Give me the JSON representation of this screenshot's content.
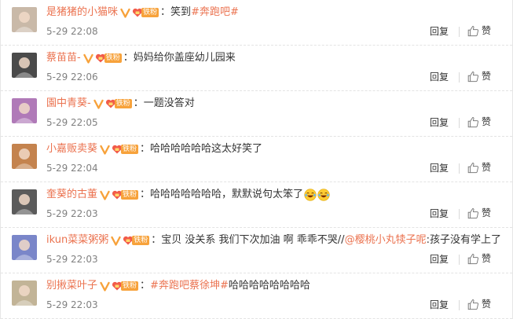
{
  "comments": [
    {
      "user": "是猪猪的小猫咪",
      "badge": "铁粉",
      "segments": [
        {
          "t": "笑到",
          "c": "ctext"
        },
        {
          "t": "#奔跑吧#",
          "c": "topic"
        }
      ],
      "time": "5-29 22:08",
      "reply": "回复",
      "like": "赞",
      "avatar_color": "#c9b9a8"
    },
    {
      "user": "蔡苗苗-",
      "badge": "铁粉",
      "segments": [
        {
          "t": "妈妈给你盖座幼儿园来",
          "c": "ctext"
        }
      ],
      "time": "5-29 22:06",
      "reply": "回复",
      "like": "赞",
      "avatar_color": "#4a4a4a"
    },
    {
      "user": "園中青葵-",
      "badge": "铁粉",
      "segments": [
        {
          "t": "一题没答对",
          "c": "ctext"
        }
      ],
      "time": "5-29 22:05",
      "reply": "回复",
      "like": "赞",
      "avatar_color": "#b07ab8"
    },
    {
      "user": "小嘉贩卖葵",
      "badge": "铁粉",
      "segments": [
        {
          "t": "哈哈哈哈哈哈这太好笑了",
          "c": "ctext"
        }
      ],
      "time": "5-29 22:04",
      "reply": "回复",
      "like": "赞",
      "avatar_color": "#c4834e"
    },
    {
      "user": "奎葵的古董",
      "badge": "铁粉",
      "segments": [
        {
          "t": "哈哈哈哈哈哈哈，默默说句太笨了",
          "c": "ctext"
        }
      ],
      "emoji": "laughing-emoji",
      "emoji_count": 2,
      "time": "5-29 22:03",
      "reply": "回复",
      "like": "赞",
      "avatar_color": "#5b5b5b"
    },
    {
      "user": "ikun菜菜粥粥",
      "badge": "铁粉",
      "segments": [
        {
          "t": "宝贝 没关系 我们下次加油 啊 乖乖不哭//",
          "c": "ctext"
        },
        {
          "t": "@樱桃小丸犊子呢",
          "c": "mention"
        },
        {
          "t": ":孩子没有学上了",
          "c": "ctext"
        }
      ],
      "time": "5-29 22:03",
      "reply": "回复",
      "like": "赞",
      "avatar_color": "#7a86c9"
    },
    {
      "user": "别揪菜叶子",
      "badge": "铁粉",
      "segments": [
        {
          "t": "#奔跑吧蔡徐坤#",
          "c": "topic"
        },
        {
          "t": " 哈哈哈哈哈哈哈哈",
          "c": "ctext"
        }
      ],
      "time": "5-29 22:03",
      "reply": "回复",
      "like": "赞",
      "avatar_color": "#c2b497"
    }
  ],
  "colors": {
    "username": "#eb7350",
    "link": "#eb7350",
    "verified": "#f7a23b",
    "fan_badge": "#f7a23b",
    "time": "#808080"
  },
  "icons": {
    "verified": "verified-v-icon",
    "fan": "fan-badge-icon",
    "like": "thumbs-up-icon"
  }
}
